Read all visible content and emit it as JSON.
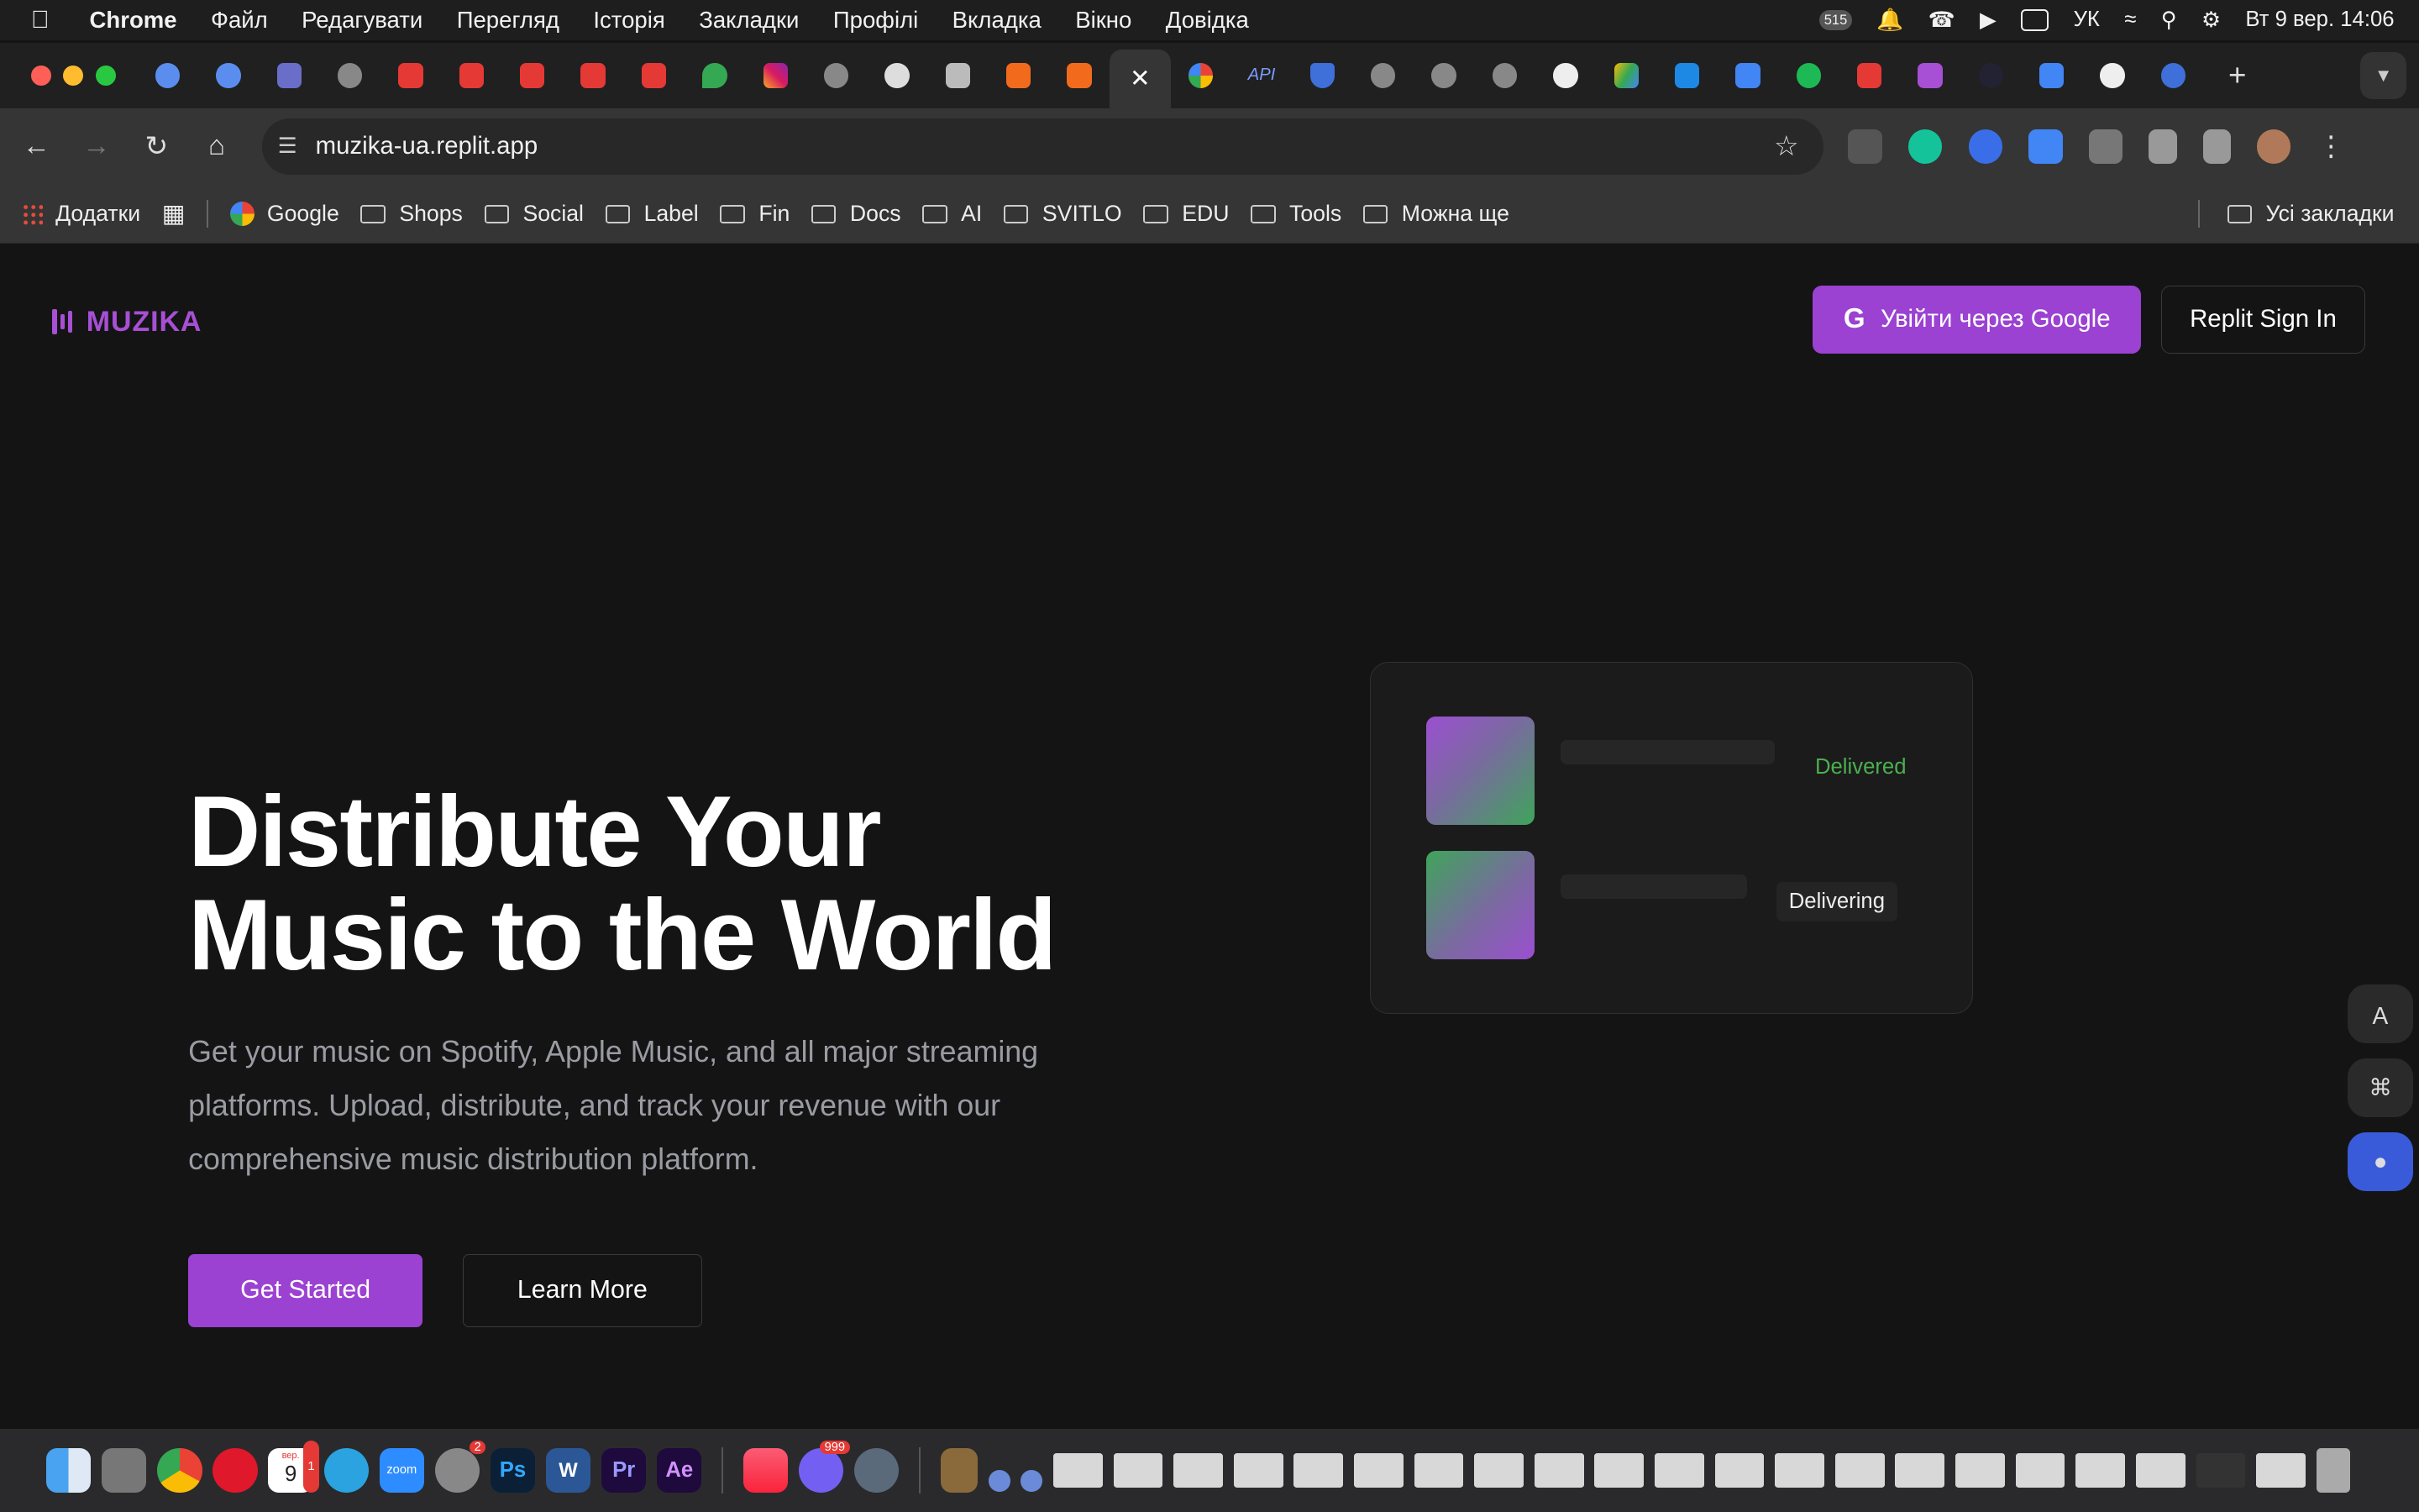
{
  "menubar": {
    "app_name": "Chrome",
    "items": [
      "Файл",
      "Редагувати",
      "Перегляд",
      "Історія",
      "Закладки",
      "Профілі",
      "Вкладка",
      "Вікно",
      "Довідка"
    ],
    "notification_count": "515",
    "input_language": "УК",
    "datetime": "Вт 9 вер.  14:06"
  },
  "browser": {
    "url": "muzika-ua.replit.app",
    "tab_api_label": "API"
  },
  "bookmarks": {
    "apps_label": "Додатки",
    "items": [
      "Google",
      "Shops",
      "Social",
      "Label",
      "Fin",
      "Docs",
      "AI",
      "SVITLO",
      "EDU",
      "Tools",
      "Можна ще"
    ],
    "all_label": "Усі закладки"
  },
  "page": {
    "logo": "MUZIKA",
    "google_button": "Увійти через Google",
    "replit_button": "Replit Sign In",
    "hero_title_line1": "Distribute Your",
    "hero_title_line2": "Music to the World",
    "hero_subtitle": "Get your music on Spotify, Apple Music, and all major streaming platforms. Upload, distribute, and track your revenue with our comprehensive music distribution platform.",
    "cta_primary": "Get Started",
    "cta_secondary": "Learn More",
    "status_delivered": "Delivered",
    "status_delivering": "Delivering"
  },
  "dock": {
    "calendar_month": "вер.",
    "calendar_day": "9",
    "calendar_badge": "1",
    "settings_badge": "2",
    "viber_badge": "999",
    "zoom_label": "zoom",
    "photoshop_label": "Ps",
    "word_label": "W",
    "premiere_label": "Pr",
    "aftereffects_label": "Ae"
  },
  "colors": {
    "accent": "#9b42d2",
    "delivered": "#4caf50",
    "background": "#141414"
  }
}
